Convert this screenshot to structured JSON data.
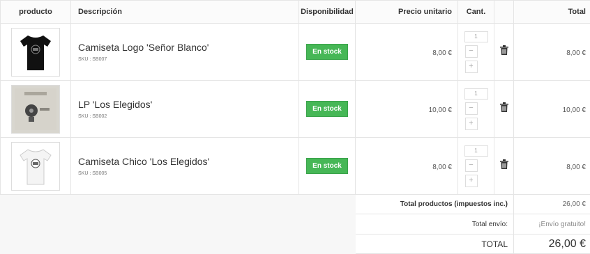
{
  "header": {
    "producto": "producto",
    "descripcion": "Descripción",
    "disponibilidad": "Disponibilidad",
    "precio": "Precio unitario",
    "cant": "Cant.",
    "total": "Total"
  },
  "items": [
    {
      "name": "Camiseta Logo 'Señor Blanco'",
      "sku": "SKU : SB007",
      "stock": "En stock",
      "price": "8,00 €",
      "qty": "1",
      "minus": "−",
      "plus": "+",
      "total": "8,00 €"
    },
    {
      "name": "LP 'Los Elegidos'",
      "sku": "SKU : SB002",
      "stock": "En stock",
      "price": "10,00 €",
      "qty": "1",
      "minus": "−",
      "plus": "+",
      "total": "10,00 €"
    },
    {
      "name": "Camiseta Chico 'Los Elegidos'",
      "sku": "SKU : SB005",
      "stock": "En stock",
      "price": "8,00 €",
      "qty": "1",
      "minus": "−",
      "plus": "+",
      "total": "8,00 €"
    }
  ],
  "summary": {
    "products_label": "Total productos (impuestos inc.)",
    "products_value": "26,00 €",
    "shipping_label": "Total envío:",
    "shipping_value": "¡Envío gratuito!",
    "total_label": "TOTAL",
    "total_value": "26,00 €"
  },
  "icons": {
    "delete": "trash-icon",
    "stock_color": "#46b756"
  }
}
